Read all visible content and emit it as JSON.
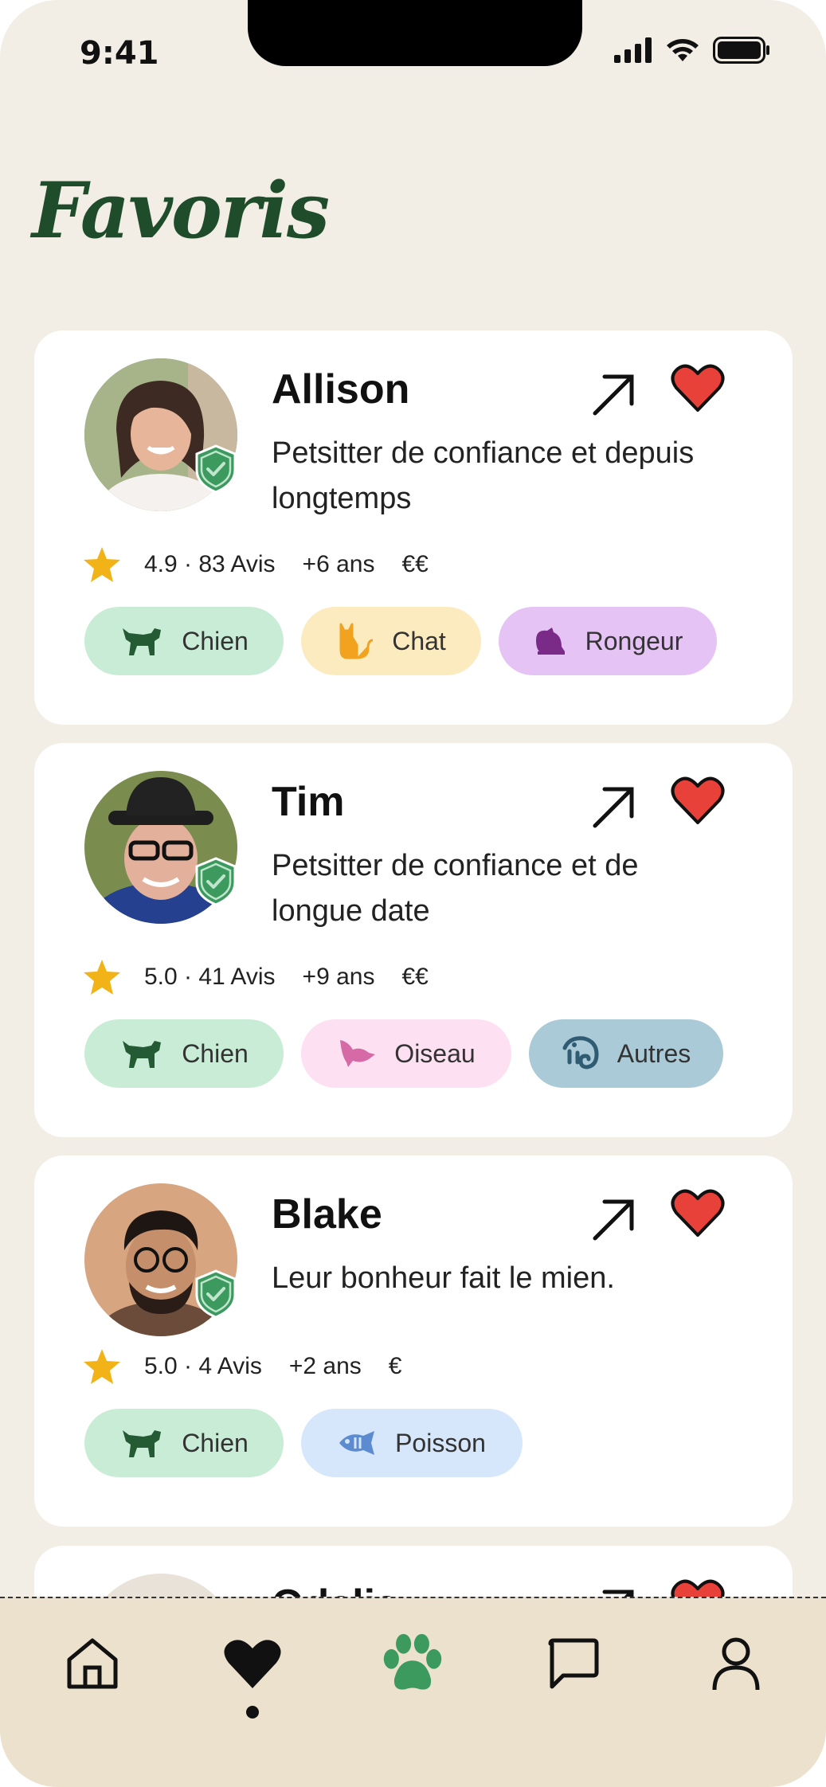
{
  "status_bar": {
    "time": "9:41"
  },
  "page": {
    "title": "Favoris"
  },
  "sitters": [
    {
      "name": "Allison",
      "tagline": "Petsitter de confiance et depuis longtemps",
      "rating": "4.9 · 83 Avis",
      "experience": "+6 ans",
      "price": "€€",
      "tags": [
        {
          "label": "Chien",
          "icon": "dog-icon",
          "bg": "#c9ecd6"
        },
        {
          "label": "Chat",
          "icon": "cat-icon",
          "bg": "#fdebc0"
        },
        {
          "label": "Rongeur",
          "icon": "rodent-icon",
          "bg": "#e5c3f5"
        }
      ]
    },
    {
      "name": "Tim",
      "tagline": "Petsitter de confiance et de longue date",
      "rating": "5.0 · 41 Avis",
      "experience": "+9 ans",
      "price": "€€",
      "tags": [
        {
          "label": "Chien",
          "icon": "dog-icon",
          "bg": "#c9ecd6"
        },
        {
          "label": "Oiseau",
          "icon": "bird-icon",
          "bg": "#fde0f2"
        },
        {
          "label": "Autres",
          "icon": "chameleon-icon",
          "bg": "#a9cad6"
        }
      ]
    },
    {
      "name": "Blake",
      "tagline": "Leur bonheur fait le mien.",
      "rating": "5.0 · 4 Avis",
      "experience": "+2 ans",
      "price": "€",
      "tags": [
        {
          "label": "Chien",
          "icon": "dog-icon",
          "bg": "#c9ecd6"
        },
        {
          "label": "Poisson",
          "icon": "fish-icon",
          "bg": "#d6e6fb"
        }
      ]
    },
    {
      "name": "Odelia",
      "tagline": "",
      "rating": "",
      "experience": "",
      "price": "",
      "tags": []
    }
  ],
  "tabbar": {
    "items": [
      {
        "icon": "home-icon",
        "active": false
      },
      {
        "icon": "heart-icon",
        "active": true
      },
      {
        "icon": "paw-icon",
        "active": false
      },
      {
        "icon": "chat-icon",
        "active": false
      },
      {
        "icon": "profile-icon",
        "active": false
      }
    ]
  },
  "colors": {
    "background": "#f3eee5",
    "title_green": "#1f4d2b",
    "heart_red": "#e8413a",
    "star_yellow": "#f1b318",
    "badge_green": "#3c9a5f",
    "tabbar_bg": "#ebe1cd"
  }
}
